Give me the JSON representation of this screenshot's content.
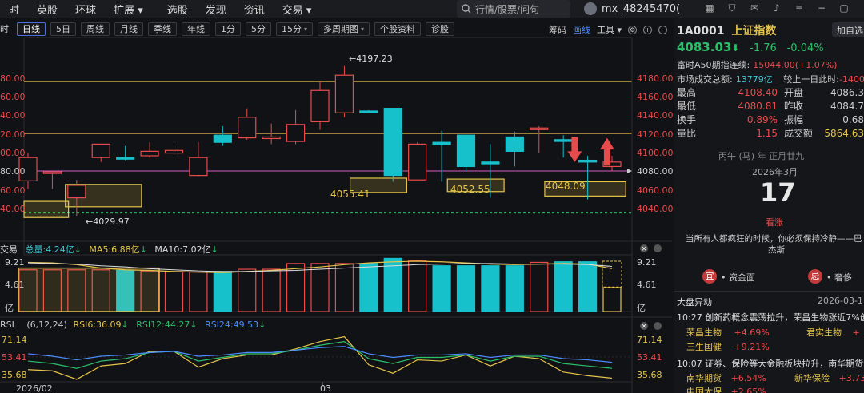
{
  "topnav": {
    "items": [
      "时",
      "英股",
      "环球",
      "扩展",
      "选股",
      "发现",
      "资讯",
      "交易"
    ],
    "search_placeholder": "行情/股票/问句",
    "username": "mx_48245470("
  },
  "toolbar": {
    "buttons": [
      "时",
      "日线",
      "5日",
      "周线",
      "月线",
      "季线",
      "年线",
      "1分",
      "5分",
      "15分",
      "多周期图",
      "个股资料",
      "诊股"
    ],
    "active": "日线",
    "right": [
      "筹码",
      "画线",
      "工具"
    ],
    "right_active": "画线"
  },
  "chart": {
    "price_axis_right": [
      "4180.00",
      "4160.00",
      "4140.00",
      "4120.00",
      "4100.00",
      "4080.00",
      "4060.00",
      "4040.00"
    ],
    "price_axis_left": [
      "80.00",
      "60.00",
      "40.00",
      "20.00",
      "00.00",
      "80.00",
      "60.00",
      "40.00"
    ],
    "high_label": "4197.23",
    "low_label": "4029.97",
    "box_labels": [
      "4055.41",
      "4052.55",
      "4048.09"
    ],
    "colors": {
      "up": "#e84b4b",
      "down": "#17c1cc",
      "ma_yellow": "#e5c44a",
      "line_pink": "#d25ec0"
    }
  },
  "chart_data": {
    "type": "candlestick",
    "x": [
      "2026/02",
      "",
      "",
      "",
      "",
      "",
      "",
      "",
      "",
      "",
      "",
      "",
      "",
      "03",
      "",
      "",
      "",
      "",
      "",
      "",
      "",
      "",
      "",
      "",
      ""
    ],
    "open": [
      4069,
      4079,
      4050,
      4095,
      4095,
      4097,
      4100,
      4075,
      4120,
      4117,
      4117,
      4113,
      4135,
      4145,
      4147,
      4150,
      4070,
      4112,
      4120,
      4090,
      4118,
      4127,
      4115,
      4092,
      4085
    ],
    "close": [
      4095,
      4079,
      4064,
      4110,
      4094,
      4102,
      4103,
      4095,
      4112,
      4140,
      4118,
      4132,
      4170,
      4187,
      4145,
      4075,
      4110,
      4110,
      4085,
      4088,
      4102,
      4128,
      4113,
      4090,
      4090
    ],
    "high": [
      4100,
      4080,
      4070,
      4110,
      4108,
      4112,
      4110,
      4112,
      4130,
      4150,
      4133,
      4148,
      4180,
      4197.23,
      4148,
      4098,
      4112,
      4125,
      4120,
      4110,
      4124,
      4130,
      4120,
      4097,
      4097
    ],
    "low": [
      4060,
      4060,
      4029.97,
      4090,
      4092,
      4095,
      4098,
      4074,
      4108,
      4115,
      4110,
      4110,
      4126,
      4140,
      4145,
      4068,
      4080,
      4068,
      4080,
      4050,
      4085,
      4100,
      4095,
      4048.09,
      4080
    ],
    "ylim": [
      4030,
      4197
    ],
    "last_price": "4083.03"
  },
  "volume": {
    "title": "交易",
    "total": "总量:4.24亿",
    "ma5": "MA5:6.88亿",
    "ma10": "MA10:7.02亿",
    "ticks": [
      "9.21",
      "4.61",
      "亿"
    ],
    "values": [
      7.3,
      7.3,
      7.3,
      7.3,
      7.2,
      7.1,
      7.0,
      6.9,
      7.0,
      7.4,
      7.4,
      8.4,
      8.4,
      8.4,
      8.4,
      9.3,
      8.9,
      8.0,
      8.0,
      8.0,
      8.0,
      8.6,
      8.7,
      8.7,
      4.2
    ],
    "ylim": [
      0,
      9.5
    ]
  },
  "rsi": {
    "title": "RSI",
    "params": "(6,12,24)",
    "rsi6": "RSI6:36.09",
    "rsi12": "RSI12:44.27",
    "rsi24": "RSI24:49.53",
    "ticks": [
      "71.14",
      "53.41",
      "35.68"
    ],
    "rsi6_values": [
      43,
      42,
      35,
      46,
      48,
      58,
      58,
      45,
      52,
      55,
      55,
      60,
      66,
      70,
      47,
      40,
      51,
      50,
      55,
      46,
      54,
      52,
      41,
      38,
      36
    ],
    "rsi12_values": [
      50,
      48,
      44,
      50,
      52,
      57,
      58,
      50,
      53,
      56,
      56,
      59,
      63,
      66,
      52,
      48,
      53,
      53,
      55,
      50,
      54,
      54,
      48,
      46,
      44
    ],
    "rsi24_values": [
      56,
      54,
      51,
      54,
      55,
      57,
      58,
      54,
      55,
      57,
      57,
      59,
      61,
      62,
      56,
      53,
      55,
      55,
      56,
      53,
      55,
      55,
      52,
      51,
      49
    ],
    "ylim": [
      33,
      73
    ]
  },
  "xaxis": {
    "start": "2026/02",
    "mark": "03"
  },
  "side": {
    "code": "1A0001",
    "name": "上证指数",
    "price": "4083.03",
    "arrow": "⬇",
    "change": "-1.76",
    "pct": "-0.04%",
    "add_btn": "加自选",
    "a50_label": "富时A50期指连续:",
    "a50_val": "15044.00(+1.07%)",
    "turnover_label": "市场成交总额:",
    "turnover_val": "13779亿",
    "vs_label": "较上一日此时:",
    "vs_val": "-1400",
    "stats": [
      {
        "k": "最高",
        "v": "4108.40",
        "k2": "开盘",
        "v2": "4086.3"
      },
      {
        "k": "最低",
        "v": "4080.81",
        "k2": "昨收",
        "v2": "4084.7"
      },
      {
        "k": "换手",
        "v": "0.89%",
        "k2": "振幅",
        "v2": "0.68"
      },
      {
        "k": "量比",
        "v": "1.15",
        "k2": "成交额",
        "v2": "5864.63"
      }
    ],
    "lunar": "丙午 (马) 年 正月廿九",
    "month": "2026年3月",
    "day": "17",
    "fortune": "看涨",
    "quote": "当所有人都疯狂的时候，你必须保持冷静——巴",
    "quote2": "杰斯",
    "yi": "宜",
    "yi_text": "• 资金面",
    "ji": "忌",
    "ji_text": "• 奢侈",
    "news_title": "大盘异动",
    "news_date": "2026-03-1",
    "news": [
      {
        "time": "10:27",
        "text": "创新药概念震荡拉升，荣昌生物涨近7%创",
        "stocks": [
          [
            "荣昌生物",
            "+4.69%"
          ],
          [
            "君实生物",
            "+"
          ],
          [
            "三生国健",
            "+9.21%"
          ]
        ]
      },
      {
        "time": "10:07",
        "text": "证券、保险等大金融板块拉升，南华期货涨",
        "stocks": [
          [
            "南华期货",
            "+6.54%"
          ],
          [
            "新华保险",
            "+3.73"
          ],
          [
            "中国太保",
            "+2.65%"
          ]
        ]
      }
    ]
  }
}
